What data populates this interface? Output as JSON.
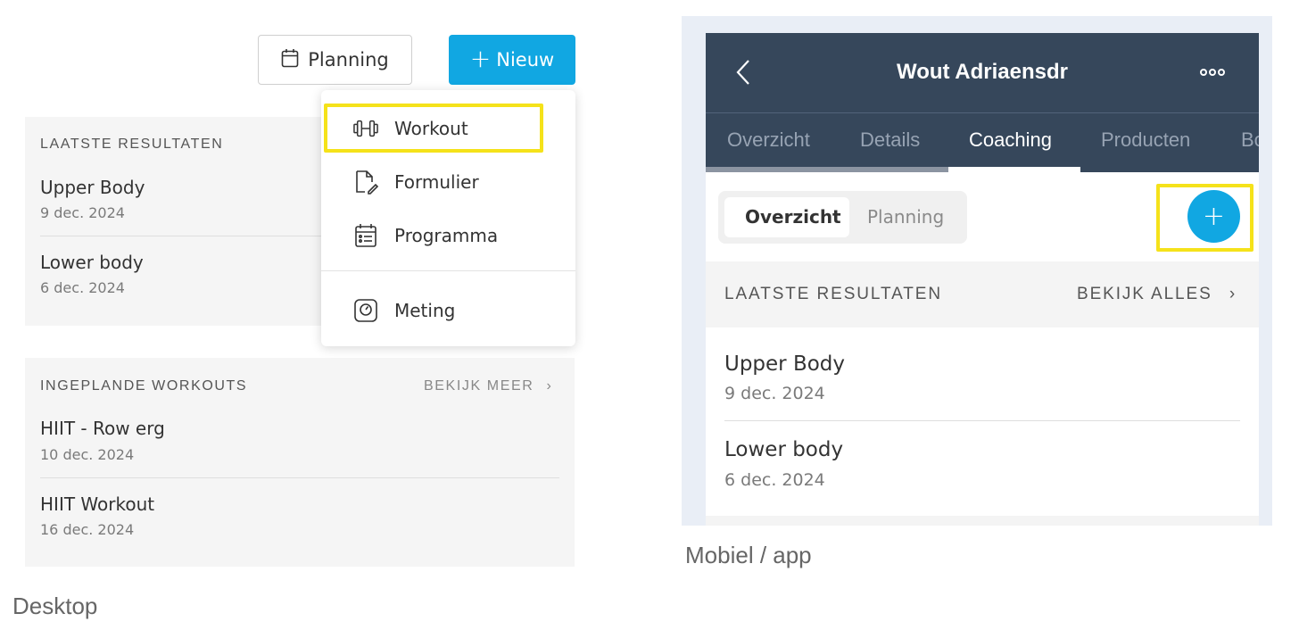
{
  "desktop": {
    "planning_button": "Planning",
    "new_button": "Nieuw",
    "accent_color": "#11a7e2",
    "highlight_color": "#f5e21a",
    "latest_results": {
      "heading": "LAATSTE RESULTATEN",
      "items": [
        {
          "title": "Upper Body",
          "date": "9 dec. 2024"
        },
        {
          "title": "Lower body",
          "date": "6 dec. 2024"
        }
      ]
    },
    "planned_workouts": {
      "heading": "INGEPLANDE WORKOUTS",
      "link": "BEKIJK MEER",
      "items": [
        {
          "title": "HIIT - Row erg",
          "date": "10 dec. 2024"
        },
        {
          "title": "HIIT Workout",
          "date": "16 dec. 2024"
        }
      ]
    },
    "menu": {
      "items": [
        {
          "label": "Workout",
          "icon": "dumbbell-icon"
        },
        {
          "label": "Formulier",
          "icon": "form-edit-icon"
        },
        {
          "label": "Programma",
          "icon": "calendar-list-icon"
        },
        {
          "label": "Meting",
          "icon": "scale-icon"
        }
      ]
    },
    "caption": "Desktop"
  },
  "mobile": {
    "header_title": "Wout Adriaensdr",
    "tabs": [
      "Overzicht",
      "Details",
      "Coaching",
      "Producten",
      "Bo"
    ],
    "active_tab": "Coaching",
    "segment": [
      "Overzicht",
      "Planning"
    ],
    "active_segment": "Overzicht",
    "section_heading": "LAATSTE RESULTATEN",
    "section_link": "BEKIJK ALLES",
    "items": [
      {
        "title": "Upper Body",
        "date": "9 dec. 2024"
      },
      {
        "title": "Lower body",
        "date": "6 dec. 2024"
      }
    ],
    "header_color": "#36475b",
    "caption": "Mobiel / app"
  }
}
